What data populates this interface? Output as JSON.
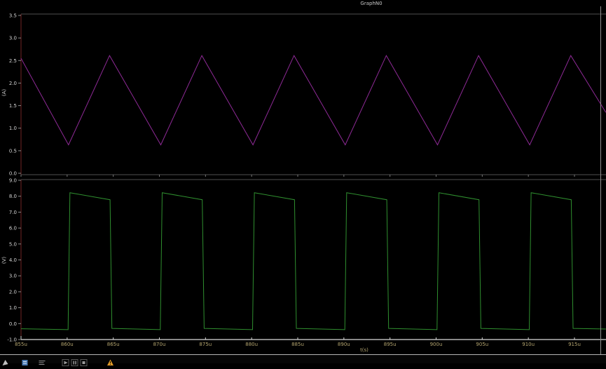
{
  "window": {
    "title": "GraphN0"
  },
  "colors": {
    "background": "#000000",
    "frame_gray": "#4f4f4f",
    "axis_bright": "#b5b5b5",
    "spine_red": "#6f2424",
    "y_tick_label": "#d4d4d4",
    "x_tick_label": "#b3a46f",
    "axis_unit_label": "#cfcfcf",
    "cursor_line": "#8f8f8f",
    "magenta_trace": "#8e2a96",
    "green_trace": "#2f8f2f"
  },
  "chart_data": [
    {
      "type": "line",
      "name": "inductor-current-trace",
      "title": "",
      "ylabel": "(A)",
      "color": "#8e2a96",
      "xlim": [
        855,
        918.4
      ],
      "ylim": [
        0.0,
        3.5
      ],
      "x_unit": "u",
      "grid": false,
      "legend": "none",
      "yticks": [
        {
          "v": 3.5,
          "label": "3.5"
        },
        {
          "v": 3.0,
          "label": "3.0"
        },
        {
          "v": 2.5,
          "label": "2.5"
        },
        {
          "v": 2.0,
          "label": "2.0"
        },
        {
          "v": 1.5,
          "label": "1.5"
        },
        {
          "v": 1.0,
          "label": "1.0"
        },
        {
          "v": 0.5,
          "label": "0.5"
        },
        {
          "v": 0.0,
          "label": "0.0"
        }
      ],
      "points": [
        [
          855.0,
          2.55
        ],
        [
          860.15,
          0.63
        ],
        [
          864.6,
          2.61
        ],
        [
          870.15,
          0.63
        ],
        [
          874.6,
          2.61
        ],
        [
          880.15,
          0.63
        ],
        [
          884.6,
          2.61
        ],
        [
          890.15,
          0.63
        ],
        [
          894.6,
          2.61
        ],
        [
          900.15,
          0.63
        ],
        [
          904.6,
          2.61
        ],
        [
          910.15,
          0.63
        ],
        [
          914.6,
          2.61
        ],
        [
          918.4,
          1.35
        ]
      ]
    },
    {
      "type": "line",
      "name": "switch-node-voltage-trace",
      "title": "",
      "ylabel": "(V)",
      "xlabel": "t(s)",
      "color": "#2f8f2f",
      "xlim": [
        855,
        918.4
      ],
      "ylim": [
        -1.0,
        9.0
      ],
      "x_unit": "u",
      "grid": false,
      "legend": "none",
      "yticks": [
        {
          "v": 9.0,
          "label": "9.0"
        },
        {
          "v": 8.0,
          "label": "8.0"
        },
        {
          "v": 7.0,
          "label": "7.0"
        },
        {
          "v": 6.0,
          "label": "6.0"
        },
        {
          "v": 5.0,
          "label": "5.0"
        },
        {
          "v": 4.0,
          "label": "4.0"
        },
        {
          "v": 3.0,
          "label": "3.0"
        },
        {
          "v": 2.0,
          "label": "2.0"
        },
        {
          "v": 1.0,
          "label": "1.0"
        },
        {
          "v": 0.0,
          "label": "0.0"
        },
        {
          "v": -1.0,
          "label": "-1.0"
        }
      ],
      "xticks": [
        {
          "t": 855,
          "label": "855u"
        },
        {
          "t": 860,
          "label": "860u"
        },
        {
          "t": 865,
          "label": "865u"
        },
        {
          "t": 870,
          "label": "870u"
        },
        {
          "t": 875,
          "label": "875u"
        },
        {
          "t": 880,
          "label": "880u"
        },
        {
          "t": 885,
          "label": "885u"
        },
        {
          "t": 890,
          "label": "890u"
        },
        {
          "t": 895,
          "label": "895u"
        },
        {
          "t": 900,
          "label": "900u"
        },
        {
          "t": 905,
          "label": "905u"
        },
        {
          "t": 910,
          "label": "910u"
        },
        {
          "t": 915,
          "label": "915u"
        }
      ],
      "points": [
        [
          855.0,
          -0.32
        ],
        [
          860.1,
          -0.38
        ],
        [
          860.3,
          8.22
        ],
        [
          864.65,
          7.78
        ],
        [
          864.85,
          -0.3
        ],
        [
          870.1,
          -0.38
        ],
        [
          870.3,
          8.22
        ],
        [
          874.65,
          7.78
        ],
        [
          874.85,
          -0.3
        ],
        [
          880.1,
          -0.38
        ],
        [
          880.3,
          8.22
        ],
        [
          884.65,
          7.78
        ],
        [
          884.85,
          -0.3
        ],
        [
          890.1,
          -0.38
        ],
        [
          890.3,
          8.22
        ],
        [
          894.65,
          7.78
        ],
        [
          894.85,
          -0.3
        ],
        [
          900.1,
          -0.38
        ],
        [
          900.3,
          8.22
        ],
        [
          904.65,
          7.78
        ],
        [
          904.85,
          -0.3
        ],
        [
          910.1,
          -0.38
        ],
        [
          910.3,
          8.22
        ],
        [
          914.65,
          7.78
        ],
        [
          914.85,
          -0.3
        ],
        [
          918.4,
          -0.34
        ]
      ]
    }
  ],
  "status_bar": {
    "icons": [
      {
        "name": "grip-icon",
        "type": "grip",
        "color": "#c0c0c0"
      },
      {
        "name": "document-icon",
        "type": "doc",
        "color": "#4a7ab5"
      },
      {
        "name": "log-lines-icon",
        "type": "lines",
        "color": "#8f8f8f"
      },
      {
        "name": "play-button",
        "type": "play",
        "color": "#9a9a9a"
      },
      {
        "name": "pause-button",
        "type": "pause",
        "color": "#9a9a9a"
      },
      {
        "name": "stop-button",
        "type": "stop",
        "color": "#9a9a9a"
      },
      {
        "name": "warning-icon",
        "type": "warning",
        "color": "#e09a28"
      }
    ]
  }
}
